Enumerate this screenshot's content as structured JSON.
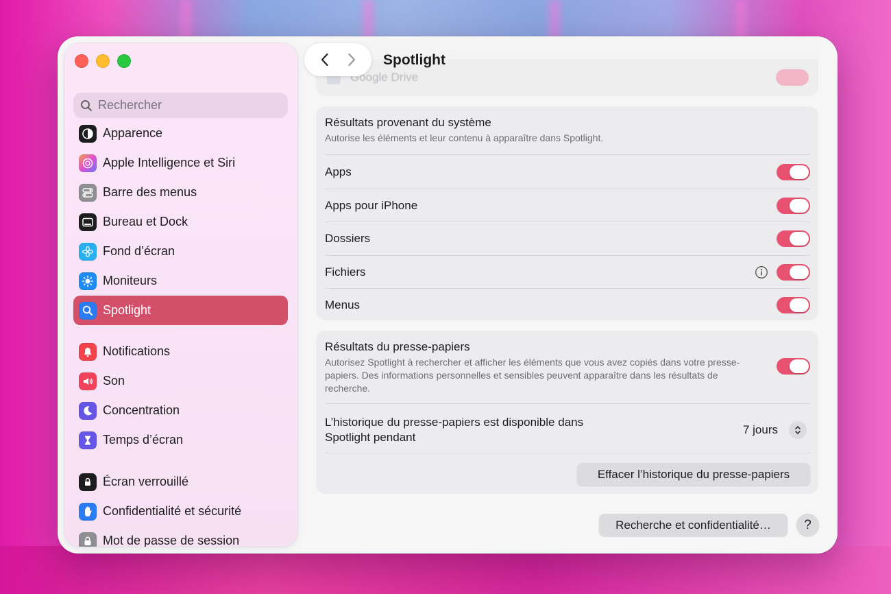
{
  "window": {
    "title": "Spotlight"
  },
  "sidebar": {
    "search_placeholder": "Rechercher",
    "items": [
      {
        "label": "Apparence",
        "icon": "appearance-icon",
        "color": "#1d1d1f"
      },
      {
        "label": "Apple Intelligence et Siri",
        "icon": "siri-icon",
        "color": "#d465e6"
      },
      {
        "label": "Barre des menus",
        "icon": "menubar-icon",
        "color": "#8e8e93"
      },
      {
        "label": "Bureau et Dock",
        "icon": "dock-icon",
        "color": "#1d1d1f"
      },
      {
        "label": "Fond d’écran",
        "icon": "flower-icon",
        "color": "#2ab0f0"
      },
      {
        "label": "Moniteurs",
        "icon": "sun-icon",
        "color": "#1f8cf5"
      },
      {
        "label": "Spotlight",
        "icon": "magnifier-icon",
        "color": "#2b7cf2",
        "active": true
      },
      {
        "label": "Notifications",
        "icon": "bell-icon",
        "color": "#f2434c"
      },
      {
        "label": "Son",
        "icon": "speaker-icon",
        "color": "#f2435d"
      },
      {
        "label": "Concentration",
        "icon": "moon-icon",
        "color": "#6656e6"
      },
      {
        "label": "Temps d’écran",
        "icon": "hourglass-icon",
        "color": "#6656e6"
      },
      {
        "label": "Écran verrouillé",
        "icon": "lock-screen-icon",
        "color": "#1d1d1f"
      },
      {
        "label": "Confidentialité et sécurité",
        "icon": "hand-icon",
        "color": "#2b7cf2"
      },
      {
        "label": "Mot de passe de session",
        "icon": "padlock-icon",
        "color": "#8e8e93"
      }
    ]
  },
  "content": {
    "ghost_row_label": "Google Drive",
    "system_card": {
      "title": "Résultats provenant du système",
      "subtitle": "Autorise les éléments et leur contenu à apparaître dans Spotlight.",
      "rows": [
        {
          "label": "Apps",
          "on": true
        },
        {
          "label": "Apps pour iPhone",
          "on": true
        },
        {
          "label": "Dossiers",
          "on": true
        },
        {
          "label": "Fichiers",
          "on": true,
          "info": true
        },
        {
          "label": "Menus",
          "on": true
        }
      ]
    },
    "clipboard_card": {
      "title": "Résultats du presse-papiers",
      "subtitle": "Autorisez Spotlight à rechercher et afficher les éléments que vous avez copiés dans votre presse-papiers. Des informations personnelles et sensibles peuvent apparaître dans les résultats de recherche.",
      "toggle_on": true,
      "history_label": "L’historique du presse-papiers est disponible dans Spotlight pendant",
      "history_value": "7 jours",
      "clear_button": "Effacer l’historique du presse-papiers"
    },
    "privacy_button": "Recherche et confidentialité…",
    "help_button": "?"
  },
  "colors": {
    "accent": "#e8516f",
    "selection": "#d44f6a"
  }
}
